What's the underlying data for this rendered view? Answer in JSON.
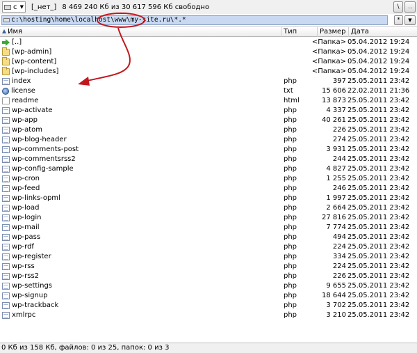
{
  "drive_bar": {
    "drive_letter": "c",
    "volume_label": "[_нет_]",
    "free_space": "8 469 240 Кб из 30 617 596 Кб свободно",
    "root_button": "\\",
    "up_button": ".."
  },
  "path_bar": {
    "path": "c:\\hosting\\home\\localhost\\www\\my-site.ru\\*.*",
    "history_button": "*",
    "dropdown_icon": "chevron-down-icon"
  },
  "columns": {
    "name": "Имя",
    "type": "Тип",
    "size": "Размер",
    "date": "Дата"
  },
  "files": [
    {
      "name": "[..]",
      "type": "",
      "size": "<Папка>",
      "date": "05.04.2012 19:24",
      "icon": "up-arrow-icon"
    },
    {
      "name": "[wp-admin]",
      "type": "",
      "size": "<Папка>",
      "date": "05.04.2012 19:24",
      "icon": "folder-icon"
    },
    {
      "name": "[wp-content]",
      "type": "",
      "size": "<Папка>",
      "date": "05.04.2012 19:24",
      "icon": "folder-icon"
    },
    {
      "name": "[wp-includes]",
      "type": "",
      "size": "<Папка>",
      "date": "05.04.2012 19:24",
      "icon": "folder-icon"
    },
    {
      "name": "index",
      "type": "php",
      "size": "397",
      "date": "25.05.2011 23:42",
      "icon": "php-file-icon"
    },
    {
      "name": "license",
      "type": "txt",
      "size": "15 606",
      "date": "22.02.2011 21:36",
      "icon": "txt-file-icon"
    },
    {
      "name": "readme",
      "type": "html",
      "size": "13 873",
      "date": "25.05.2011 23:42",
      "icon": "html-file-icon"
    },
    {
      "name": "wp-activate",
      "type": "php",
      "size": "4 337",
      "date": "25.05.2011 23:42",
      "icon": "php-file-icon"
    },
    {
      "name": "wp-app",
      "type": "php",
      "size": "40 261",
      "date": "25.05.2011 23:42",
      "icon": "php-file-icon"
    },
    {
      "name": "wp-atom",
      "type": "php",
      "size": "226",
      "date": "25.05.2011 23:42",
      "icon": "php-file-icon"
    },
    {
      "name": "wp-blog-header",
      "type": "php",
      "size": "274",
      "date": "25.05.2011 23:42",
      "icon": "php-file-icon"
    },
    {
      "name": "wp-comments-post",
      "type": "php",
      "size": "3 931",
      "date": "25.05.2011 23:42",
      "icon": "php-file-icon"
    },
    {
      "name": "wp-commentsrss2",
      "type": "php",
      "size": "244",
      "date": "25.05.2011 23:42",
      "icon": "php-file-icon"
    },
    {
      "name": "wp-config-sample",
      "type": "php",
      "size": "4 827",
      "date": "25.05.2011 23:42",
      "icon": "php-file-icon"
    },
    {
      "name": "wp-cron",
      "type": "php",
      "size": "1 255",
      "date": "25.05.2011 23:42",
      "icon": "php-file-icon"
    },
    {
      "name": "wp-feed",
      "type": "php",
      "size": "246",
      "date": "25.05.2011 23:42",
      "icon": "php-file-icon"
    },
    {
      "name": "wp-links-opml",
      "type": "php",
      "size": "1 997",
      "date": "25.05.2011 23:42",
      "icon": "php-file-icon"
    },
    {
      "name": "wp-load",
      "type": "php",
      "size": "2 664",
      "date": "25.05.2011 23:42",
      "icon": "php-file-icon"
    },
    {
      "name": "wp-login",
      "type": "php",
      "size": "27 816",
      "date": "25.05.2011 23:42",
      "icon": "php-file-icon"
    },
    {
      "name": "wp-mail",
      "type": "php",
      "size": "7 774",
      "date": "25.05.2011 23:42",
      "icon": "php-file-icon"
    },
    {
      "name": "wp-pass",
      "type": "php",
      "size": "494",
      "date": "25.05.2011 23:42",
      "icon": "php-file-icon"
    },
    {
      "name": "wp-rdf",
      "type": "php",
      "size": "224",
      "date": "25.05.2011 23:42",
      "icon": "php-file-icon"
    },
    {
      "name": "wp-register",
      "type": "php",
      "size": "334",
      "date": "25.05.2011 23:42",
      "icon": "php-file-icon"
    },
    {
      "name": "wp-rss",
      "type": "php",
      "size": "224",
      "date": "25.05.2011 23:42",
      "icon": "php-file-icon"
    },
    {
      "name": "wp-rss2",
      "type": "php",
      "size": "226",
      "date": "25.05.2011 23:42",
      "icon": "php-file-icon"
    },
    {
      "name": "wp-settings",
      "type": "php",
      "size": "9 655",
      "date": "25.05.2011 23:42",
      "icon": "php-file-icon"
    },
    {
      "name": "wp-signup",
      "type": "php",
      "size": "18 644",
      "date": "25.05.2011 23:42",
      "icon": "php-file-icon"
    },
    {
      "name": "wp-trackback",
      "type": "php",
      "size": "3 702",
      "date": "25.05.2011 23:42",
      "icon": "php-file-icon"
    },
    {
      "name": "xmlrpc",
      "type": "php",
      "size": "3 210",
      "date": "25.05.2011 23:42",
      "icon": "php-file-icon"
    }
  ],
  "status_bar": {
    "text": "0 Кб из 158 Кб, файлов: 0 из 25, папок: 0 из 3"
  },
  "annotation": {
    "color": "#c0181e"
  },
  "colors": {
    "path_highlight": "#c9d9f2",
    "folder": "#f6dc84",
    "up_arrow": "#3aa83a"
  }
}
